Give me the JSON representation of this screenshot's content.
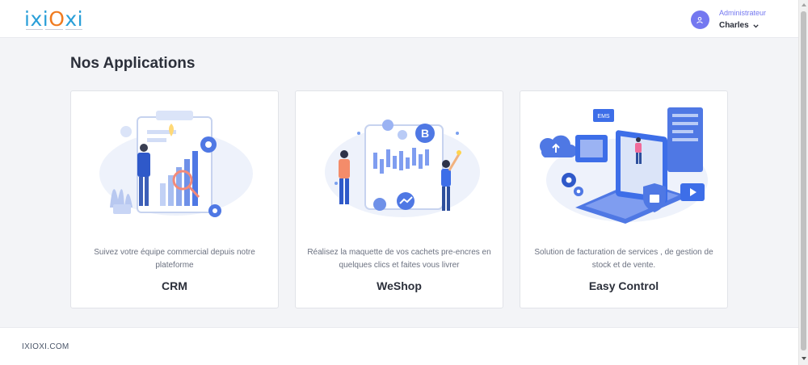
{
  "header": {
    "logo": {
      "part1": "ixi",
      "part2": "O",
      "part3": "xi"
    },
    "user": {
      "role": "Administrateur",
      "name": "Charles"
    }
  },
  "main": {
    "title": "Nos Applications",
    "apps": [
      {
        "name": "CRM",
        "description": "Suivez votre équipe commercial depuis notre plateforme"
      },
      {
        "name": "WeShop",
        "description": "Réalisez la maquette de vos cachets pre-encres en quelques clics et faites vous livrer"
      },
      {
        "name": "Easy Control",
        "description": "Solution de facturation de services , de gestion de stock et de vente."
      }
    ]
  },
  "footer": {
    "text": "IXIOXI.COM"
  },
  "colors": {
    "accent": "#7478f0",
    "brand_blue": "#2a9fd8",
    "brand_orange": "#f07b1f",
    "illustration_blue": "#3d6ee8"
  },
  "icons": [
    "user-avatar-icon",
    "chevron-down-icon",
    "bitcoin-icon",
    "dollar-coin-icon",
    "gear-icon",
    "lock-icon",
    "cloud-upload-icon"
  ]
}
